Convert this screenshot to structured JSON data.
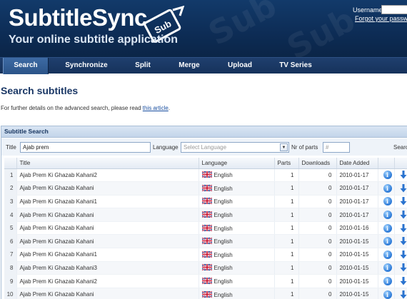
{
  "brand": {
    "name": "SubtitleSync",
    "badge_text": "Sub",
    "tagline": "Your online subtitle application"
  },
  "login": {
    "username_label": "Username",
    "forgot_link": "Forgot your password?"
  },
  "nav": {
    "items": [
      {
        "label": "Search",
        "active": true
      },
      {
        "label": "Synchronize",
        "active": false
      },
      {
        "label": "Split",
        "active": false
      },
      {
        "label": "Merge",
        "active": false
      },
      {
        "label": "Upload",
        "active": false
      },
      {
        "label": "TV Series",
        "active": false
      }
    ]
  },
  "main": {
    "title": "Search subtitles",
    "intro_text": "For further details on the advanced search, please read ",
    "intro_link": "this article",
    "intro_end": "."
  },
  "search_panel": {
    "title": "Subtitle Search",
    "title_label": "Title",
    "title_value": "Ajab prem",
    "language_label": "Language",
    "language_placeholder": "Select Language",
    "parts_label": "Nr of parts",
    "parts_placeholder": "#",
    "search_button": "Search"
  },
  "table": {
    "columns": [
      "",
      "Title",
      "Language",
      "Parts",
      "Downloads",
      "Date Added",
      "",
      ""
    ],
    "rows": [
      {
        "n": "1",
        "title": "Ajab Prem Ki Ghazab Kahani2",
        "language": "English",
        "parts": "1",
        "downloads": "0",
        "date": "2010-01-17"
      },
      {
        "n": "2",
        "title": "Ajab Prem Ki Ghazab Kahani",
        "language": "English",
        "parts": "1",
        "downloads": "0",
        "date": "2010-01-17"
      },
      {
        "n": "3",
        "title": "Ajab Prem Ki Ghazab Kahani1",
        "language": "English",
        "parts": "1",
        "downloads": "0",
        "date": "2010-01-17"
      },
      {
        "n": "4",
        "title": "Ajab Prem Ki Ghazab Kahani",
        "language": "English",
        "parts": "1",
        "downloads": "0",
        "date": "2010-01-17"
      },
      {
        "n": "5",
        "title": "Ajab Prem Ki Ghazab Kahani",
        "language": "English",
        "parts": "1",
        "downloads": "0",
        "date": "2010-01-16"
      },
      {
        "n": "6",
        "title": "Ajab Prem Ki Ghazab Kahani",
        "language": "English",
        "parts": "1",
        "downloads": "0",
        "date": "2010-01-15"
      },
      {
        "n": "7",
        "title": "Ajab Prem Ki Ghazab Kahani1",
        "language": "English",
        "parts": "1",
        "downloads": "0",
        "date": "2010-01-15"
      },
      {
        "n": "8",
        "title": "Ajab Prem Ki Ghazab Kahani3",
        "language": "English",
        "parts": "1",
        "downloads": "0",
        "date": "2010-01-15"
      },
      {
        "n": "9",
        "title": "Ajab Prem Ki Ghazab Kahani2",
        "language": "English",
        "parts": "1",
        "downloads": "0",
        "date": "2010-01-15"
      },
      {
        "n": "10",
        "title": "Ajab Prem Ki Ghazab Kahani",
        "language": "English",
        "parts": "1",
        "downloads": "0",
        "date": "2010-01-15"
      }
    ],
    "info_icon": "info-icon",
    "download_icon": "download-arrow-icon"
  },
  "colors": {
    "header_bg": "#0d2c55",
    "nav_bg": "#16325b",
    "title_color": "#1b3866",
    "link_color": "#1a4fa0"
  }
}
